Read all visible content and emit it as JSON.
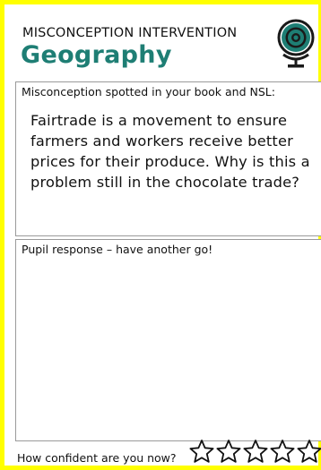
{
  "header": {
    "title": "MISCONCEPTION INTERVENTION",
    "subject": "Geography",
    "icon": "globe-target-icon",
    "accent_color": "#1e7e74",
    "border_color": "#ffff00"
  },
  "misconception": {
    "label": "Misconception spotted in your book and NSL:",
    "question": "Fairtrade is a movement to ensure farmers and workers receive better prices for their produce. Why is this a problem still in the chocolate trade?"
  },
  "response": {
    "label": "Pupil response – have another go!",
    "value": ""
  },
  "confidence": {
    "label": "How confident are you now?",
    "icon": "star-icon",
    "max_stars": 5,
    "selected": 0
  }
}
